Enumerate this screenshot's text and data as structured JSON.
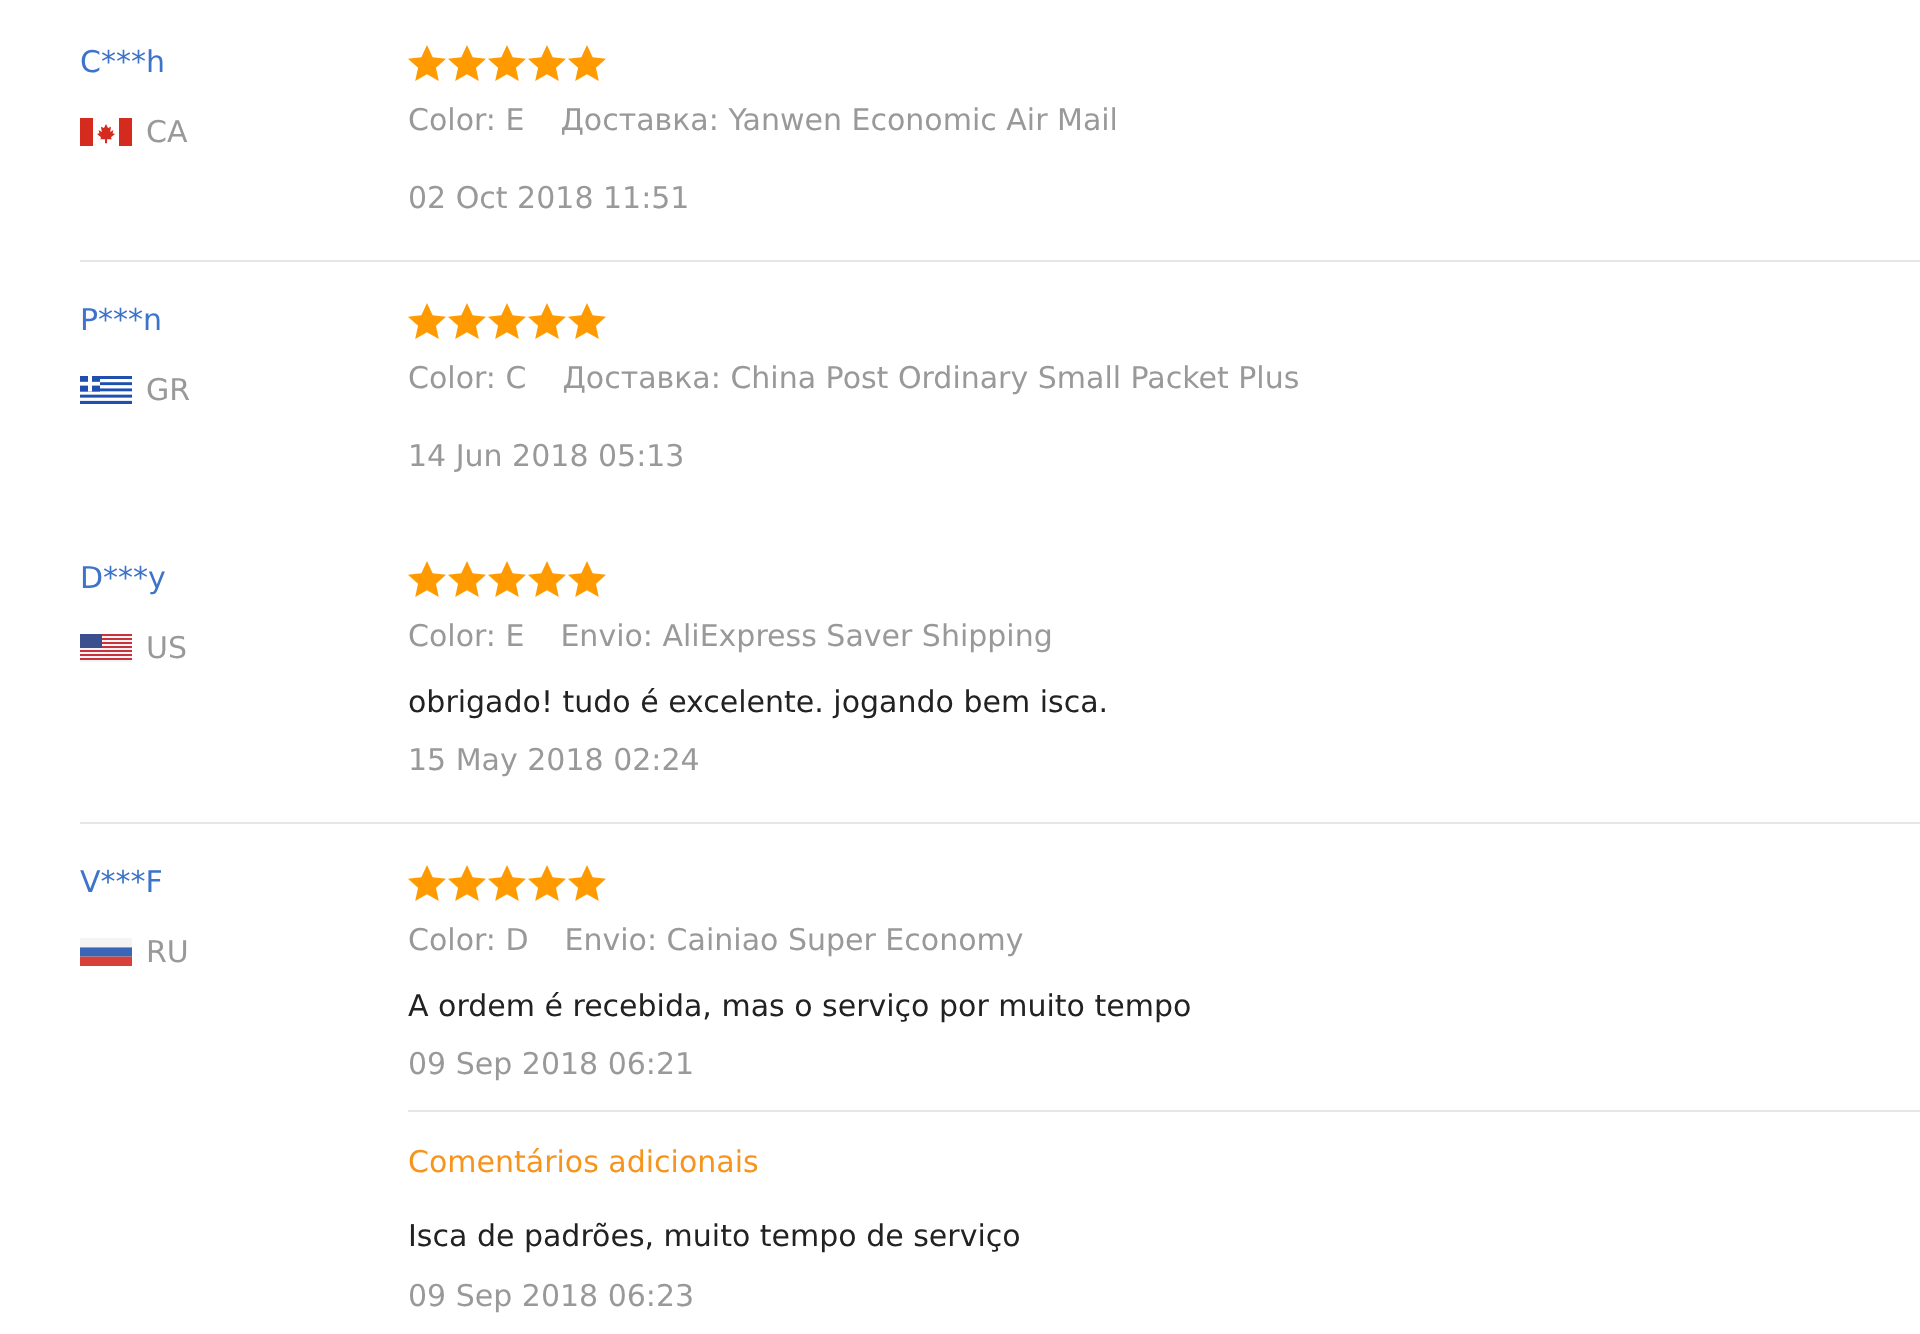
{
  "reviews": [
    {
      "reviewer": "C***h",
      "country": {
        "code": "CA",
        "kind": "canada"
      },
      "stars": 5,
      "attributes": [
        "Color: E",
        "Доставка: Yanwen Economic Air Mail"
      ],
      "date": "02 Oct 2018 11:51",
      "divider_below": true
    },
    {
      "reviewer": "P***n",
      "country": {
        "code": "GR",
        "kind": "greece"
      },
      "stars": 5,
      "attributes": [
        "Color: C",
        "Доставка: China Post Ordinary Small Packet Plus"
      ],
      "date": "14 Jun 2018 05:13",
      "divider_below": false
    },
    {
      "reviewer": "D***y",
      "country": {
        "code": "US",
        "kind": "usa"
      },
      "stars": 5,
      "attributes": [
        "Color: E",
        "Envio: AliExpress Saver Shipping"
      ],
      "comment": "obrigado! tudo é excelente. jogando bem isca.",
      "date": "15 May 2018 02:24",
      "divider_below": true
    },
    {
      "reviewer": "V***F",
      "country": {
        "code": "RU",
        "kind": "russia"
      },
      "stars": 5,
      "attributes": [
        "Color: D",
        "Envio: Cainiao Super Economy"
      ],
      "comment": "A ordem é recebida, mas o serviço por muito tempo",
      "date": "09 Sep 2018 06:21",
      "divider_below": false,
      "additional": {
        "title": "Comentários adicionais",
        "comment": "Isca de padrões, muito tempo de serviço",
        "date": "09 Sep 2018 06:23"
      }
    }
  ]
}
